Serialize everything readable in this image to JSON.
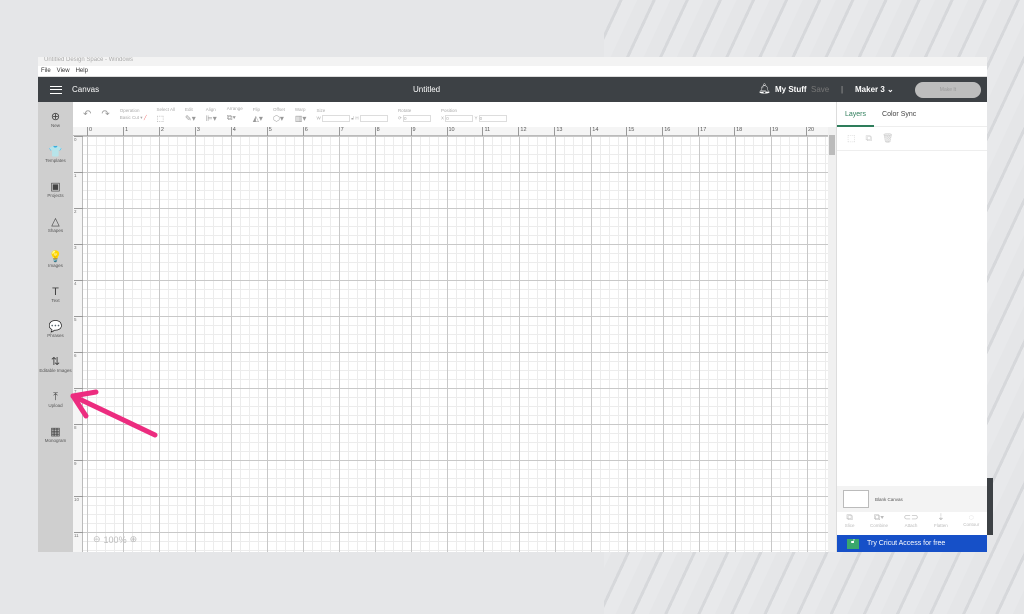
{
  "window": {
    "title_strip": "Untitled Design Space - Windows",
    "menu": [
      "File",
      "View",
      "Help"
    ]
  },
  "header": {
    "section": "Canvas",
    "title": "Untitled",
    "my_stuff": "My Stuff",
    "save": "Save",
    "separator": "|",
    "machine": "Maker 3",
    "make_it": "Make It"
  },
  "sidebar": {
    "items": [
      {
        "label": "New",
        "icon": "⊕"
      },
      {
        "label": "Templates",
        "icon": "👕"
      },
      {
        "label": "Projects",
        "icon": "▣"
      },
      {
        "label": "Shapes",
        "icon": "△"
      },
      {
        "label": "Images",
        "icon": "💡"
      },
      {
        "label": "Text",
        "icon": "T"
      },
      {
        "label": "Phrases",
        "icon": "💬"
      },
      {
        "label": "Editable Images",
        "icon": "⇅"
      },
      {
        "label": "Upload",
        "icon": "⤒"
      },
      {
        "label": "Monogram",
        "icon": "▦"
      }
    ]
  },
  "toolbar": {
    "operation_label": "Operation",
    "operation_value": "Basic Cut",
    "select_all": "Select All",
    "edit": "Edit",
    "align": "Align",
    "arrange": "Arrange",
    "flip": "Flip",
    "offset": "Offset",
    "warp": "Warp",
    "size": "Size",
    "size_w": "W",
    "size_h": "H",
    "rotate": "Rotate",
    "rotate_value": "0",
    "position": "Position",
    "pos_x": "X",
    "pos_y": "Y",
    "pos_x_value": "0",
    "pos_y_value": "0"
  },
  "ruler": {
    "top": [
      "0",
      "1",
      "2",
      "3",
      "4",
      "5",
      "6",
      "7",
      "8",
      "9",
      "10",
      "11",
      "12",
      "13",
      "14",
      "15",
      "16",
      "17",
      "18",
      "19",
      "20"
    ],
    "left": [
      "0",
      "1",
      "2",
      "3",
      "4",
      "5",
      "6",
      "7",
      "8",
      "9",
      "10",
      "11"
    ]
  },
  "zoom_level": "100%",
  "panel": {
    "tabs": [
      "Layers",
      "Color Sync"
    ],
    "layer_name": "Blank Canvas",
    "actions": [
      {
        "label": "Slice",
        "icon": "⧉"
      },
      {
        "label": "Combine",
        "icon": "⧉▾"
      },
      {
        "label": "Attach",
        "icon": "⊂⊃"
      },
      {
        "label": "Flatten",
        "icon": "⇣"
      },
      {
        "label": "Contour",
        "icon": "◌"
      }
    ],
    "banner": "Try Cricut Access for free"
  },
  "colors": {
    "header": "#3d4145",
    "accent_green": "#2e7d5b",
    "banner_blue": "#1650c8",
    "annotation_arrow": "#ec2c7f"
  }
}
